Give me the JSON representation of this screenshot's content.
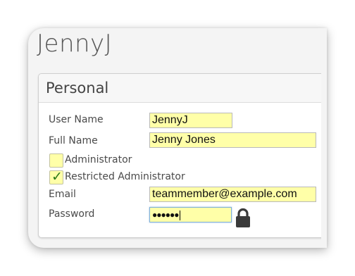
{
  "page": {
    "title": "JennyJ"
  },
  "panel": {
    "title": "Personal"
  },
  "form": {
    "user_name": {
      "label": "User Name",
      "value": "JennyJ"
    },
    "full_name": {
      "label": "Full Name",
      "value": "Jenny Jones"
    },
    "administrator": {
      "label": "Administrator",
      "checked": false
    },
    "restricted_administrator": {
      "label": "Restricted Administrator",
      "checked": true,
      "mark": "✓"
    },
    "email": {
      "label": "Email",
      "value": "teammember@example.com"
    },
    "password": {
      "label": "Password",
      "value": "●●●●●●"
    }
  },
  "icons": {
    "password_lock": "lock-icon"
  },
  "colors": {
    "field_background": "#ffffa8",
    "check_mark": "#2a7a18",
    "focus_border": "#7fb0d8"
  }
}
